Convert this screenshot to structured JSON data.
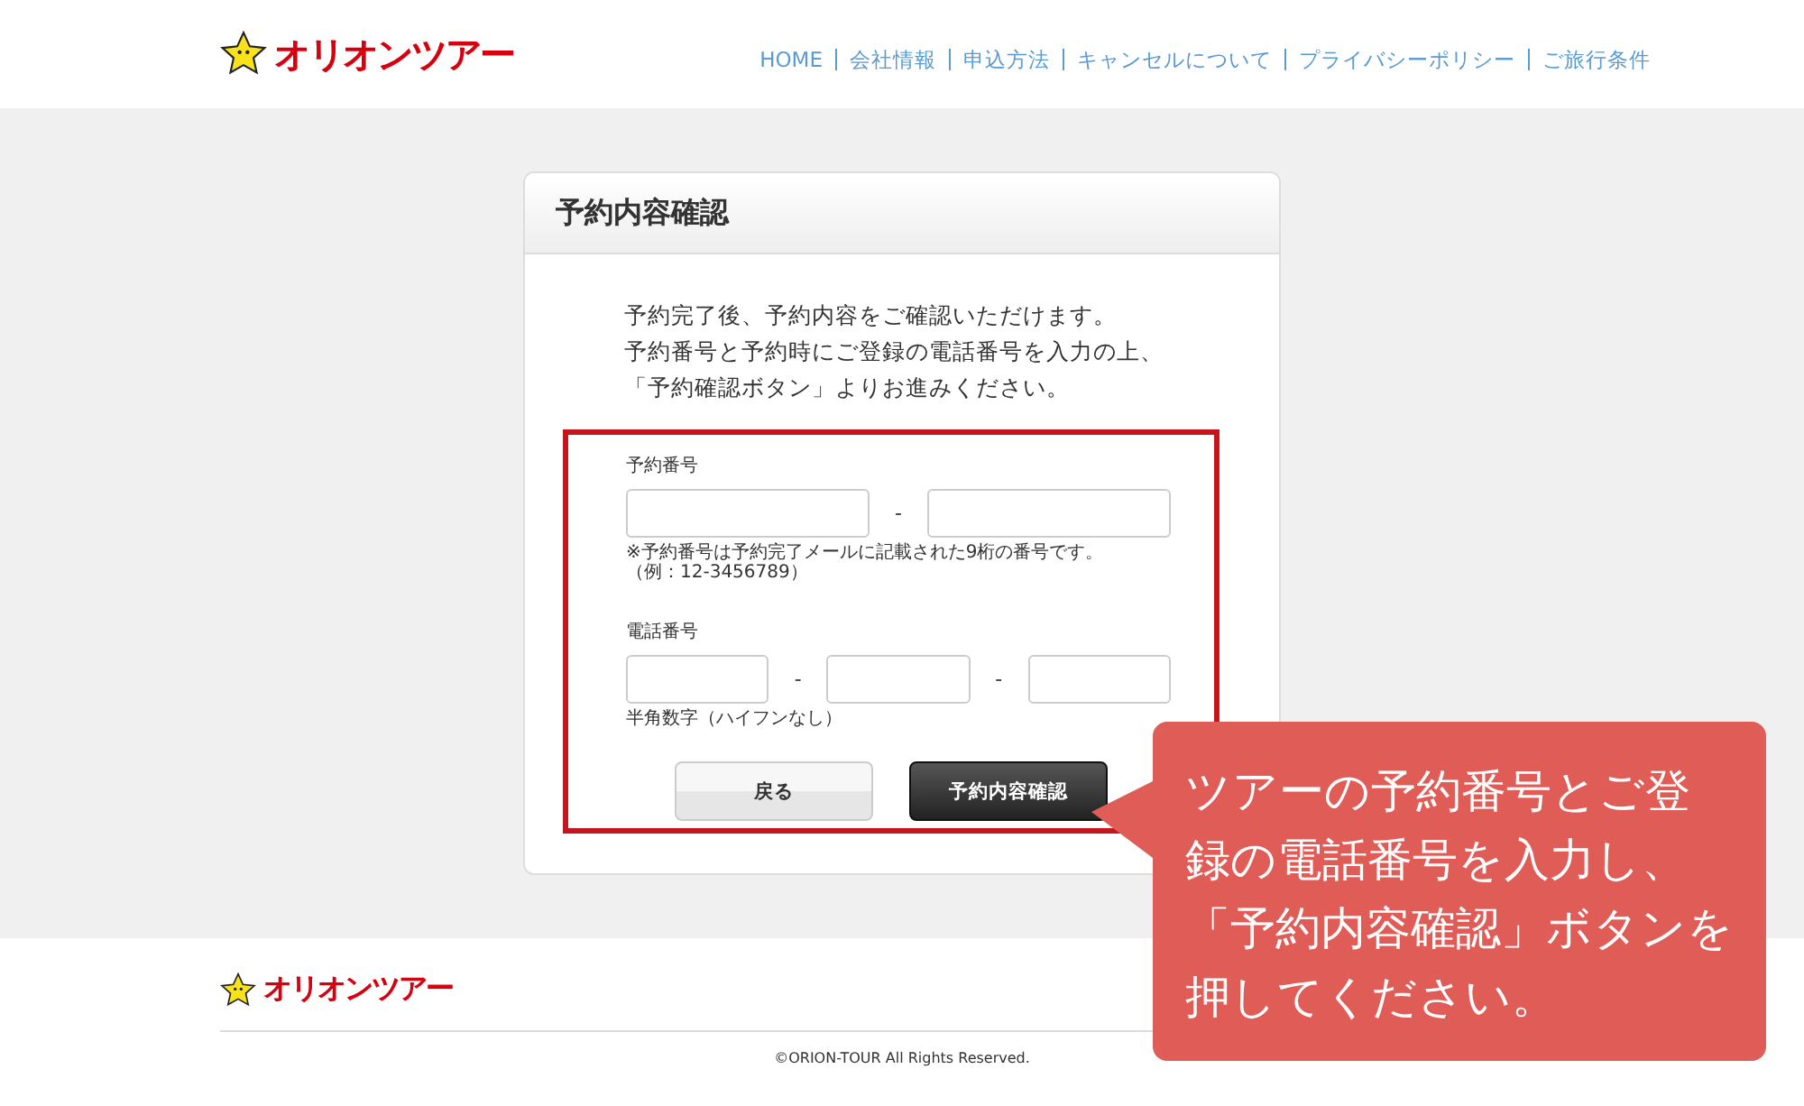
{
  "header": {
    "logo_text": "オリオンツアー",
    "nav": [
      {
        "label": "HOME"
      },
      {
        "label": "会社情報"
      },
      {
        "label": "申込方法"
      },
      {
        "label": "キャンセルについて"
      },
      {
        "label": "プライバシーポリシー"
      },
      {
        "label": "ご旅行条件"
      }
    ]
  },
  "card": {
    "title": "予約内容確認",
    "intro": [
      "予約完了後、予約内容をご確認いただけます。",
      "予約番号と予約時にご登録の電話番号を入力の上、",
      "「予約確認ボタン」よりお進みください。"
    ],
    "groups": [
      {
        "label": "予約番号",
        "parts": [
          {
            "kind": "input"
          },
          {
            "kind": "separator",
            "text": "-"
          },
          {
            "kind": "input"
          }
        ],
        "notes": [
          "※予約番号は予約完了メールに記載された9桁の番号です。",
          "（例：12-3456789）"
        ]
      },
      {
        "label": "電話番号",
        "parts": [
          {
            "kind": "input"
          },
          {
            "kind": "separator",
            "text": "-"
          },
          {
            "kind": "input"
          },
          {
            "kind": "separator",
            "text": "-"
          },
          {
            "kind": "input"
          }
        ],
        "notes": [
          "半角数字（ハイフンなし）"
        ]
      }
    ],
    "buttons": [
      {
        "label": "戻る",
        "kind": "secondary"
      },
      {
        "label": "予約内容確認",
        "kind": "primary"
      }
    ]
  },
  "callout": {
    "text": "ツアーの予約番号とご登録の電話番号を入力し、「予約内容確認」ボタンを押してください。"
  },
  "footer": {
    "logo_text": "オリオンツアー",
    "copyright": "©ORION-TOUR All Rights Reserved."
  }
}
